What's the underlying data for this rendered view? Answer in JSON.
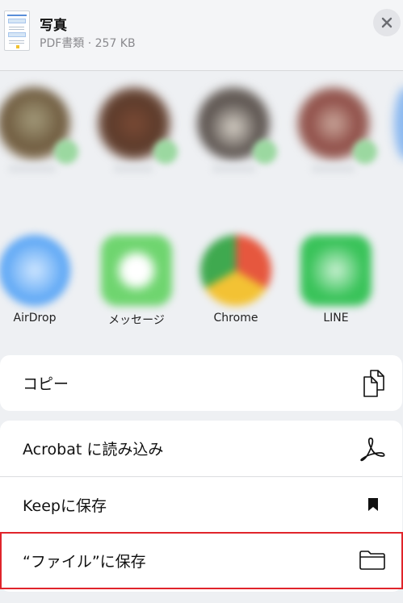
{
  "header": {
    "title": "写真",
    "subtitle": "PDF書類 · 257 KB"
  },
  "apps": [
    {
      "label": "AirDrop",
      "icon": "airdrop-icon",
      "color": "#5fa8f5"
    },
    {
      "label": "メッセージ",
      "icon": "messages-icon",
      "color": "#6fd56f"
    },
    {
      "label": "Chrome",
      "icon": "chrome-icon",
      "color": "#e6573e"
    },
    {
      "label": "LINE",
      "icon": "line-icon",
      "color": "#3ac35a"
    }
  ],
  "actions": {
    "copy": {
      "label": "コピー",
      "icon": "copy-icon"
    },
    "acrobat": {
      "label": "Acrobat に読み込み",
      "icon": "acrobat-icon"
    },
    "keep": {
      "label": "Keepに保存",
      "icon": "bookmark-icon"
    },
    "files": {
      "label": "“ファイル”に保存",
      "icon": "folder-icon"
    }
  },
  "colors": {
    "highlight": "#e0242b",
    "background": "#eef0f3"
  }
}
